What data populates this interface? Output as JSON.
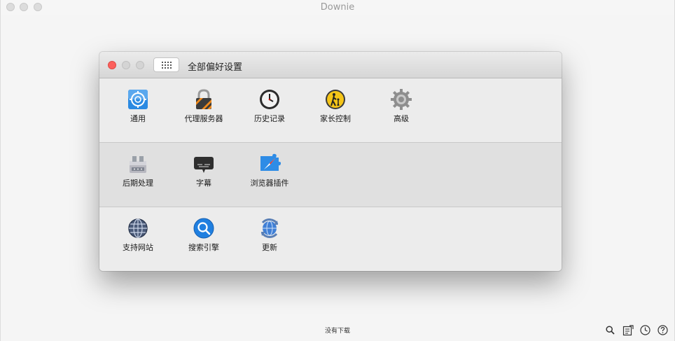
{
  "window": {
    "title": "Downie"
  },
  "status": {
    "text": "没有下载"
  },
  "prefs": {
    "title": "全部偏好设置",
    "sections": [
      {
        "items": [
          {
            "label": "通用",
            "icon": "general-icon"
          },
          {
            "label": "代理服务器",
            "icon": "lock-icon"
          },
          {
            "label": "历史记录",
            "icon": "clock-icon"
          },
          {
            "label": "家长控制",
            "icon": "parental-icon"
          },
          {
            "label": "高级",
            "icon": "gear-icon"
          }
        ]
      },
      {
        "items": [
          {
            "label": "后期处理",
            "icon": "postprocess-icon"
          },
          {
            "label": "字幕",
            "icon": "subtitle-icon"
          },
          {
            "label": "浏览器插件",
            "icon": "browser-plugin-icon"
          }
        ]
      },
      {
        "items": [
          {
            "label": "支持网站",
            "icon": "globe-icon"
          },
          {
            "label": "搜索引擎",
            "icon": "search-engine-icon"
          },
          {
            "label": "更新",
            "icon": "update-icon"
          }
        ]
      }
    ]
  },
  "colors": {
    "close": "#fc605c",
    "inactive": "#d0d0d0",
    "accent": "#2e8ce6"
  }
}
